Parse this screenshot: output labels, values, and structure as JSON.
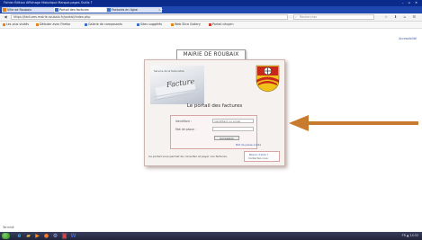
{
  "titlebar": {
    "menu": "Fichier  Édition  Affichage  Historique  Marque-pages  Outils  ?",
    "window_controls": "– ▫ ✕"
  },
  "tabs": [
    {
      "label": "Ville de Roubaix",
      "active": false
    },
    {
      "label": "Portail des factures",
      "active": true
    },
    {
      "label": "Factures en ligne",
      "active": false
    }
  ],
  "new_tab": "+",
  "navbar": {
    "back": "◀",
    "url": "https://factures.mairie-roubaix.fr/portail/index.php",
    "search_placeholder": "Rechercher"
  },
  "bookmarks": [
    {
      "label": "Les plus visités",
      "color": "#e8821e"
    },
    {
      "label": "Débuter avec Firefox",
      "color": "#e8821e"
    },
    {
      "label": "Galerie de composants",
      "color": "#3b6fc9"
    },
    {
      "label": "Sites suggérés",
      "color": "#3b6fc9"
    },
    {
      "label": "Web Slice Gallery",
      "color": "#e8821e"
    },
    {
      "label": "Portail citoyen",
      "color": "#d23a2a"
    }
  ],
  "page": {
    "topright_link": "Accessibilité",
    "banner_title": "MAIRIE DE ROUBAIX",
    "image_header": "Service de la facturation",
    "image_word": "Facture",
    "portal_title": "Le portail des factures",
    "login": {
      "user_label": "Identifiant :",
      "user_placeholder": "identifiant ou email",
      "pass_label": "Mot de passe :",
      "submit_label": "Connexion",
      "forgot_label": "Mot de passe oublié"
    },
    "footnote": "Ce portail vous permet de consulter et payer vos factures.",
    "help_link": "Besoin d'aide ?",
    "help_contact": "Contactez-nous"
  },
  "status_text": "Terminé",
  "taskbar": {
    "icons": [
      "ie-icon",
      "folder-icon",
      "media-icon",
      "firefox-icon",
      "settings-icon",
      "photo-icon",
      "word-icon"
    ],
    "tray": "FR ▲ 14:32"
  },
  "colors": {
    "titlebar": "#0a2a8c",
    "tabbar": "#1e48b0",
    "arrow": "#c87a2e",
    "panel_border": "#cbb7b2",
    "crest_red": "#c8281c",
    "crest_yellow": "#f0c21a"
  }
}
